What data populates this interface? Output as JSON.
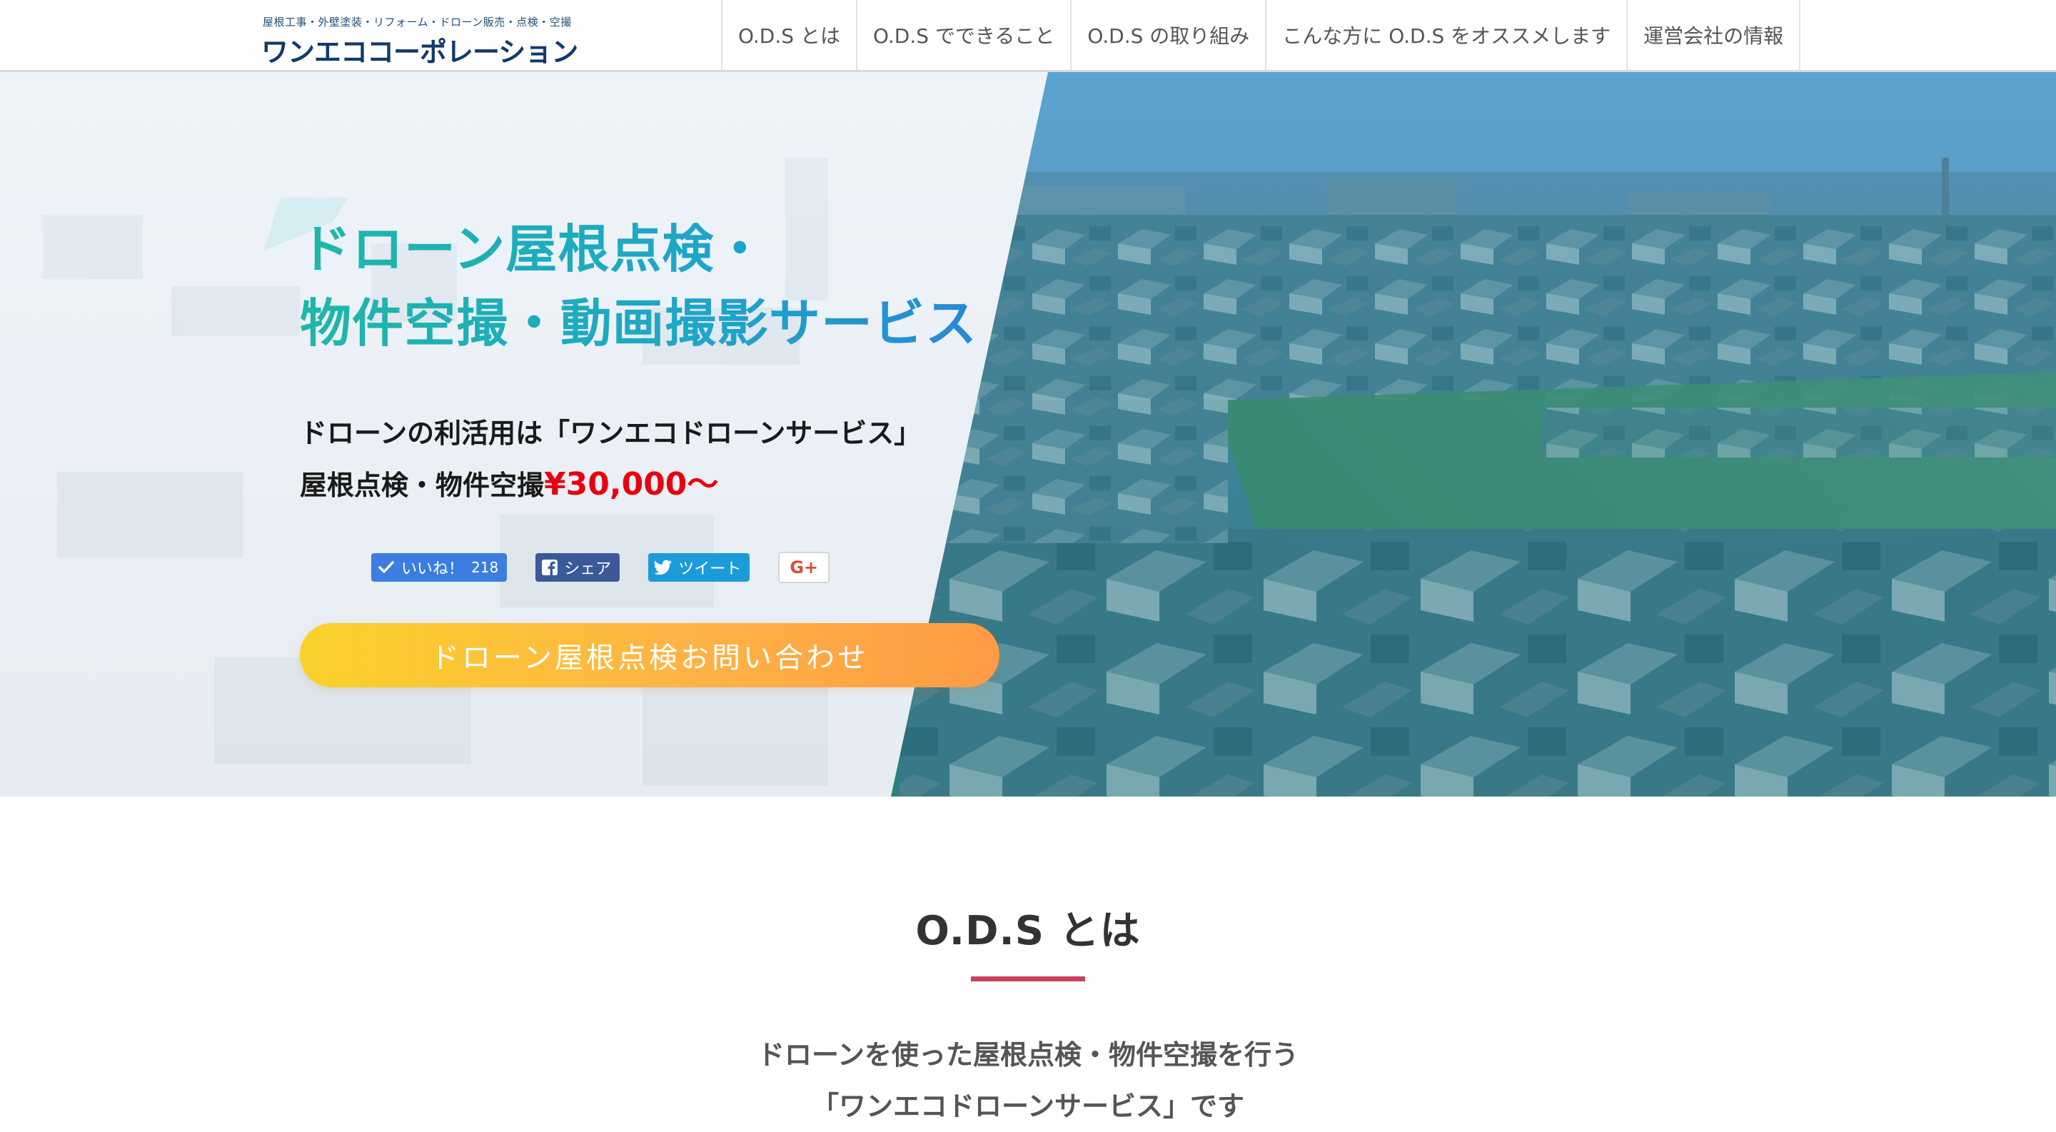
{
  "header": {
    "logo_tagline": "屋根工事・外壁塗装・リフォーム・ドローン販売・点検・空撮",
    "logo_name": "ワンエココーポレーション",
    "nav": [
      {
        "label": "O.D.S とは"
      },
      {
        "label": "O.D.S でできること"
      },
      {
        "label": "O.D.S の取り組み"
      },
      {
        "label": "こんな方に O.D.S をオススメします"
      },
      {
        "label": "運営会社の情報"
      }
    ]
  },
  "hero": {
    "title_line1": "ドローン屋根点検・",
    "title_line2": "物件空撮・動画撮影サービス",
    "sub_line1": "ドローンの利活用は「ワンエコドローンサービス」",
    "sub_line2_prefix": "屋根点検・物件空撮",
    "price": "¥30,000〜",
    "share": {
      "like_label": "いいね！",
      "like_count": "218",
      "share_label": "シェア",
      "tweet_label": "ツイート",
      "gplus_label": "G+"
    },
    "cta_label": "ドローン屋根点検お問い合わせ"
  },
  "section": {
    "title": "O.D.S とは",
    "lead_line1": "ドローンを使った屋根点検・物件空撮を行う",
    "lead_line2": "「ワンエコドローンサービス」です"
  },
  "colors": {
    "accent_underline": "#c9415a",
    "price": "#e60012",
    "title_gradient_start": "#1fb7a8",
    "title_gradient_end": "#2789d6",
    "cta_start": "#fbd12b",
    "cta_end": "#ff9a45",
    "logo": "#123a6a"
  }
}
